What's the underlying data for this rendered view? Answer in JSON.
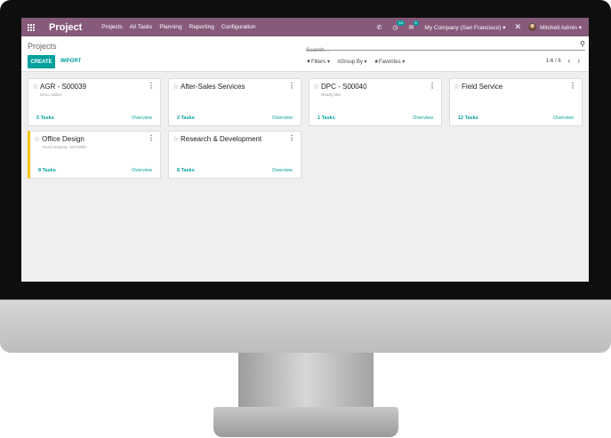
{
  "navbar": {
    "brand": "Project",
    "menu": [
      "Projects",
      "All Tasks",
      "Planning",
      "Reporting",
      "Configuration"
    ],
    "activity_count": "18",
    "message_count": "6",
    "company": "My Company (San Francisco)",
    "user": "Mitchell Admin",
    "icons": {
      "apps": "apps-grid-icon",
      "phone": "phone-icon",
      "activity": "clock-icon",
      "messages": "chat-icon",
      "close": "close-icon"
    }
  },
  "control_panel": {
    "breadcrumb": "Projects",
    "create_label": "CREATE",
    "import_label": "IMPORT",
    "search_placeholder": "Search...",
    "filters_label": "Filters",
    "group_by_label": "Group By",
    "favorites_label": "Favorites",
    "pager": "1-6 / 6"
  },
  "projects": [
    {
      "name": "AGR - S00039",
      "customer": "Deco Addict",
      "tasks": "5 Tasks",
      "overview": "Overview",
      "color": ""
    },
    {
      "name": "After-Sales Services",
      "customer": "",
      "tasks": "2 Tasks",
      "overview": "Overview",
      "color": ""
    },
    {
      "name": "DPC - S00040",
      "customer": "Ready Mat",
      "tasks": "1 Tasks",
      "overview": "Overview",
      "color": ""
    },
    {
      "name": "Field Service",
      "customer": "",
      "tasks": "12 Tasks",
      "overview": "Overview",
      "color": ""
    },
    {
      "name": "Office Design",
      "customer": "YourCompany, Joel Willis",
      "tasks": "8 Tasks",
      "overview": "Overview",
      "color": "#f4c609"
    },
    {
      "name": "Research & Development",
      "customer": "",
      "tasks": "8 Tasks",
      "overview": "Overview",
      "color": ""
    }
  ],
  "colors": {
    "navbar": "#875a7b",
    "accent": "#00a09d",
    "background": "#f0eeee"
  }
}
